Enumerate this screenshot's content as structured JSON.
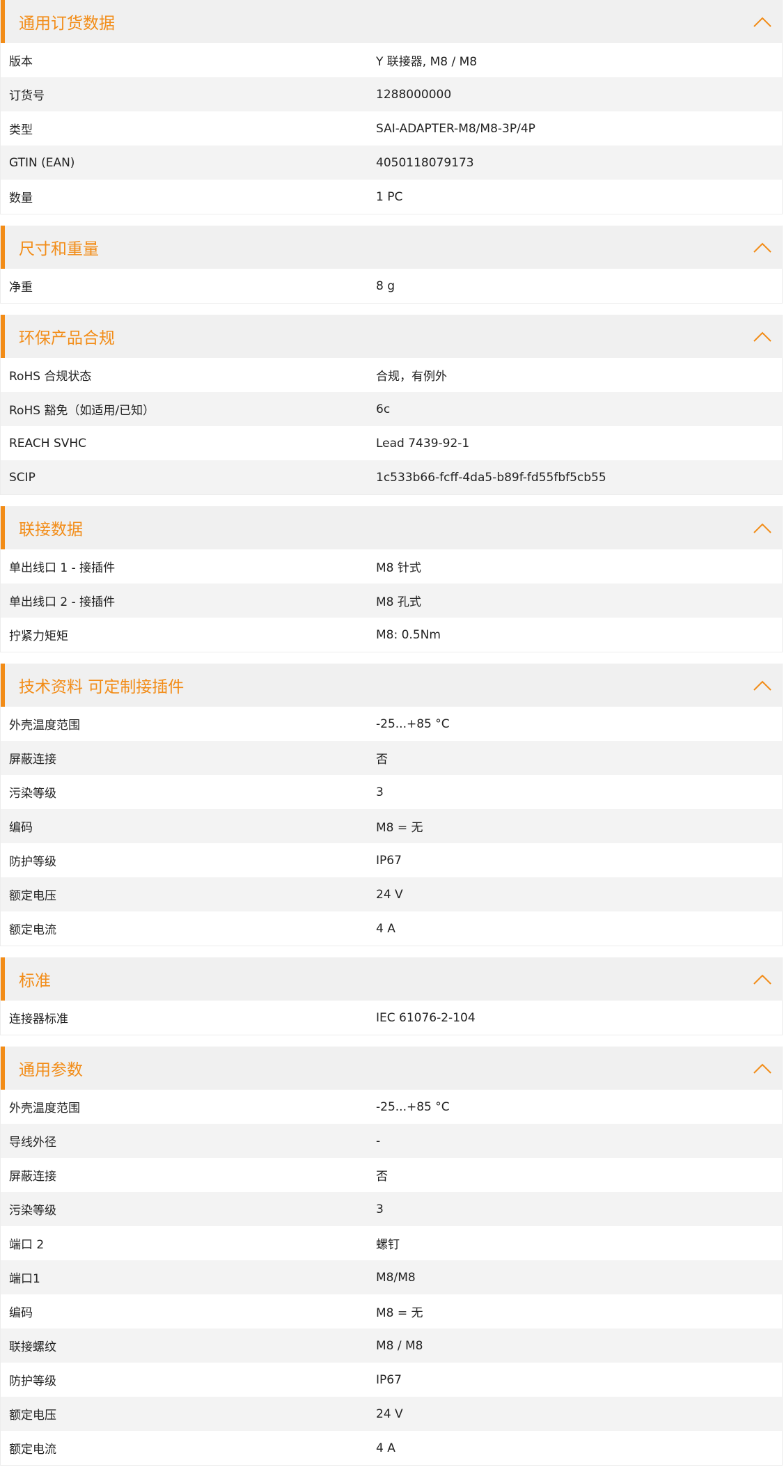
{
  "colors": {
    "accent": "#f28c17",
    "header_bg": "#f0f0f0",
    "row_alt_bg": "#f3f3f3"
  },
  "icons": {
    "collapse": "chevron-up-icon"
  },
  "sections": [
    {
      "title": "通用订货数据",
      "rows": [
        {
          "label": "版本",
          "value": "Y 联接器, M8 / M8"
        },
        {
          "label": "订货号",
          "value": "1288000000"
        },
        {
          "label": "类型",
          "value": "SAI-ADAPTER-M8/M8-3P/4P"
        },
        {
          "label": "GTIN (EAN)",
          "value": "4050118079173"
        },
        {
          "label": "数量",
          "value": "1  PC"
        }
      ]
    },
    {
      "title": "尺寸和重量",
      "rows": [
        {
          "label": "净重",
          "value": "8  g"
        }
      ]
    },
    {
      "title": "环保产品合规",
      "rows": [
        {
          "label": "RoHS 合规状态",
          "value": "合规，有例外"
        },
        {
          "label": "RoHS 豁免（如适用/已知）",
          "value": "6c"
        },
        {
          "label": "REACH SVHC",
          "value": "Lead 7439-92-1"
        },
        {
          "label": "SCIP",
          "value": "1c533b66-fcff-4da5-b89f-fd55fbf5cb55"
        }
      ]
    },
    {
      "title": "联接数据",
      "rows": [
        {
          "label": "单出线口 1 - 接插件",
          "value": "M8 针式"
        },
        {
          "label": "单出线口 2 - 接插件",
          "value": "M8 孔式"
        },
        {
          "label": "拧紧力矩矩",
          "value": "M8: 0.5Nm"
        }
      ]
    },
    {
      "title": "技术资料 可定制接插件",
      "rows": [
        {
          "label": "外壳温度范围",
          "value": "-25...+85 °C"
        },
        {
          "label": "屏蔽连接",
          "value": "否"
        },
        {
          "label": "污染等级",
          "value": "3"
        },
        {
          "label": "编码",
          "value": "M8 = 无"
        },
        {
          "label": "防护等级",
          "value": "IP67"
        },
        {
          "label": "额定电压",
          "value": "24  V"
        },
        {
          "label": "额定电流",
          "value": "4  A"
        }
      ]
    },
    {
      "title": "标准",
      "rows": [
        {
          "label": "连接器标准",
          "value": "IEC 61076-2-104"
        }
      ]
    },
    {
      "title": "通用参数",
      "rows": [
        {
          "label": "外壳温度范围",
          "value": "-25...+85 °C"
        },
        {
          "label": "导线外径",
          "value": "-"
        },
        {
          "label": "屏蔽连接",
          "value": "否"
        },
        {
          "label": "污染等级",
          "value": "3"
        },
        {
          "label": "端口 2",
          "value": "螺钉"
        },
        {
          "label": "端口1",
          "value": "M8/M8"
        },
        {
          "label": "编码",
          "value": "M8 = 无"
        },
        {
          "label": "联接螺纹",
          "value": "M8 / M8"
        },
        {
          "label": "防护等级",
          "value": "IP67"
        },
        {
          "label": "额定电压",
          "value": "24  V"
        },
        {
          "label": "额定电流",
          "value": "4  A"
        }
      ]
    }
  ]
}
